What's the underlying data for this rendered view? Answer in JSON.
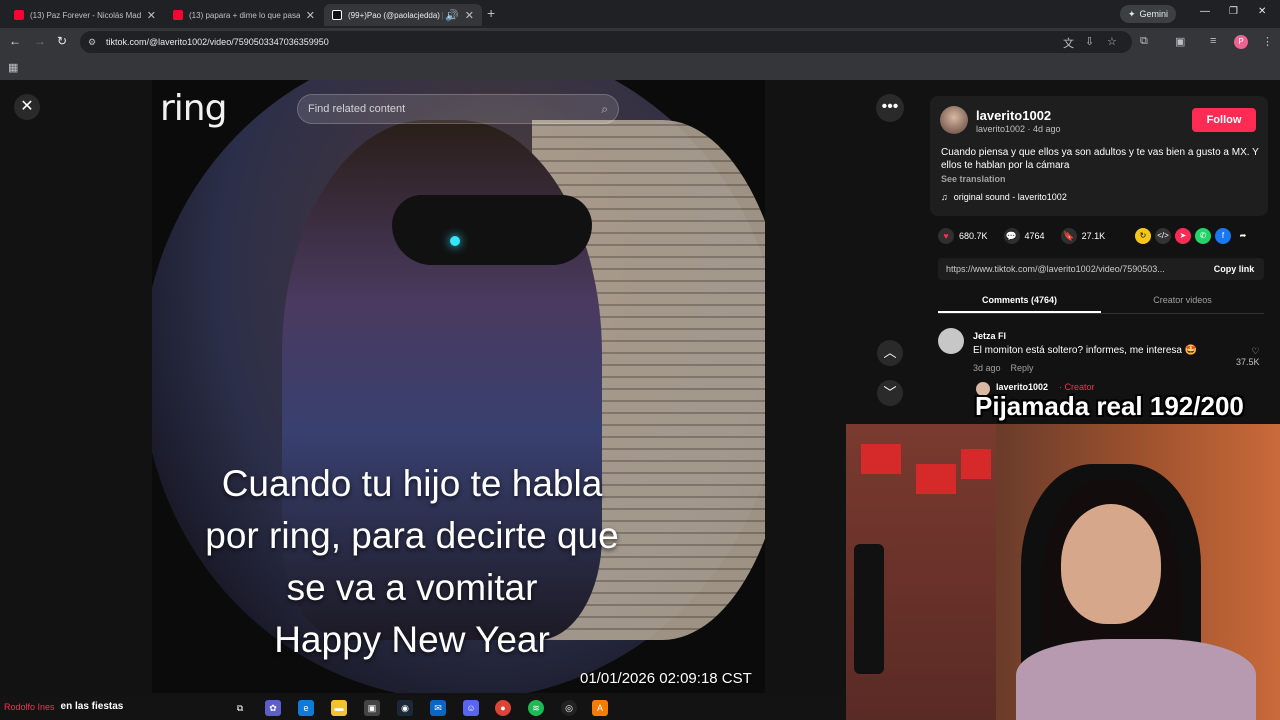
{
  "browser": {
    "tabs": [
      {
        "title": "(13) Paz Forever - Nicolás Mad",
        "favicon": "youtube-icon",
        "active": false
      },
      {
        "title": "(13) papara + dime lo que pasa",
        "favicon": "youtube-icon",
        "active": false
      },
      {
        "title": "(99+)Pao (@paolacjedda) |",
        "favicon": "tiktok-icon",
        "active": true
      }
    ],
    "gemini_label": "Gemini",
    "url": "tiktok.com/@laverito1002/video/7590503347036359950",
    "profile_initial": "P"
  },
  "video": {
    "search_placeholder": "Find related content",
    "logo_text": "ring",
    "caption_lines": [
      "Cuando tu hijo te habla",
      "por ring, para decirte que",
      "se va a vomitar",
      "Happy New Year"
    ],
    "timestamp": "01/01/2026 02:09:18 CST"
  },
  "post": {
    "username": "laverito1002",
    "subline": "laverito1002 · 4d ago",
    "follow_label": "Follow",
    "caption": "Cuando piensa y que ellos ya son adultos y te vas bien a gusto a MX. Y ellos te hablan por la cámara",
    "see_translation": "See translation",
    "sound": "original sound - laverito1002",
    "likes": "680.7K",
    "comments": "4764",
    "saves": "27.1K",
    "link": "https://www.tiktok.com/@laverito1002/video/7590503...",
    "copy_link_label": "Copy link",
    "tabs": [
      "Comments (4764)",
      "Creator videos"
    ]
  },
  "comments": [
    {
      "name": "Jetza Fl",
      "text": "El momiton está soltero? informes, me interesa 🤩",
      "age": "3d ago",
      "reply_label": "Reply",
      "likes": "37.5K"
    }
  ],
  "reply": {
    "name": "laverito1002",
    "tag": "· Creator"
  },
  "overlay": {
    "goal": "Pijamada real 192/200"
  },
  "taskbar": {
    "ticker": "Rodolfo Ines",
    "song": "en las fiestas"
  },
  "colors": {
    "accent": "#fe2c55",
    "panel": "#1e1e1e"
  }
}
